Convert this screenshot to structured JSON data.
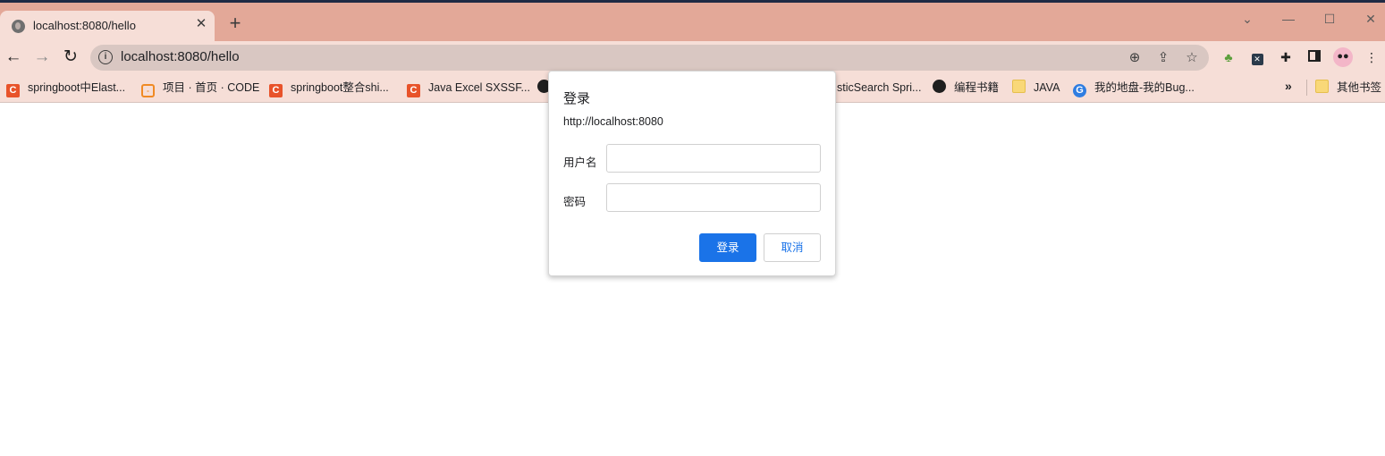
{
  "tab": {
    "title": "localhost:8080/hello",
    "close": "✕",
    "new_tab": "+"
  },
  "window_controls": {
    "tab_search": "⌄",
    "minimize": "—",
    "maximize": "☐",
    "close": "✕"
  },
  "toolbar": {
    "back": "←",
    "forward": "→",
    "reload": "↻",
    "url": "localhost:8080/hello",
    "zoom": "⊕",
    "share": "⇪",
    "star": "☆",
    "menu": "⋮"
  },
  "bookmarks": [
    {
      "label": "springboot中Elast...",
      "icon": "csdn-icon"
    },
    {
      "label": "项目 · 首页 · CODE",
      "icon": "code-icon"
    },
    {
      "label": "springboot整合shi...",
      "icon": "csdn-icon"
    },
    {
      "label": "Java Excel SXSSF...",
      "icon": "csdn-icon"
    },
    {
      "label": "sticSearch Spri...",
      "icon": "globe-icon"
    },
    {
      "label": "编程书籍",
      "icon": "github-icon"
    },
    {
      "label": "JAVA",
      "icon": "folder-icon"
    },
    {
      "label": "我的地盘-我的Bug...",
      "icon": "bug-icon"
    }
  ],
  "bookmarks_more": "»",
  "other_bookmarks": "其他书签",
  "dialog": {
    "title": "登录",
    "origin": "http://localhost:8080",
    "username_label": "用户名",
    "username_value": "",
    "password_label": "密码",
    "password_value": "",
    "ok_label": "登录",
    "cancel_label": "取消"
  },
  "colors": {
    "tabstrip": "#e3a898",
    "toolbar": "#f6ded7",
    "accent": "#1a73e8"
  }
}
